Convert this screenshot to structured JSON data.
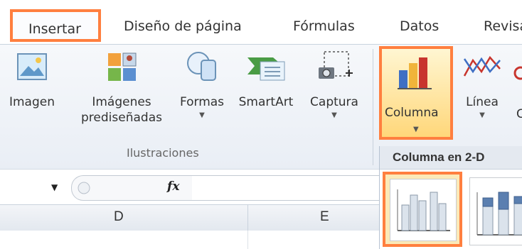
{
  "tabs": {
    "insertar": "Insertar",
    "diseno": "Diseño de página",
    "formulas": "Fórmulas",
    "datos": "Datos",
    "revisar": "Revisa"
  },
  "ribbon": {
    "imagen": "Imagen",
    "imagenes_l1": "Imágenes",
    "imagenes_l2": "prediseñadas",
    "formas": "Formas",
    "smartart": "SmartArt",
    "captura": "Captura",
    "group_label": "Ilustraciones",
    "columna": "Columna",
    "linea": "Línea",
    "partial_next": "C"
  },
  "dropdown": {
    "header": "Columna en 2-D"
  },
  "formula_bar": {
    "fx": "fx"
  },
  "columns": {
    "d": "D",
    "e": "E"
  },
  "colors": {
    "highlight_border": "#ff7f3f",
    "selected_fill": "#ffd77a"
  }
}
